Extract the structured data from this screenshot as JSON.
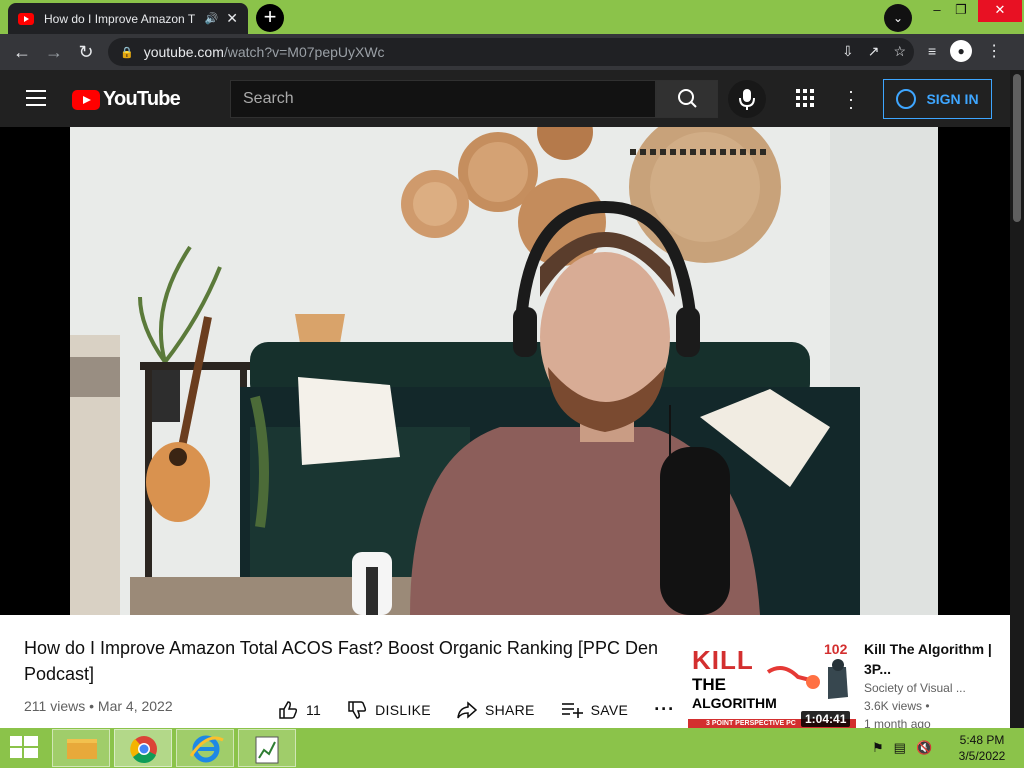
{
  "browser": {
    "tab_title": "How do I Improve Amazon T",
    "new_tab_label": "+",
    "url_host": "youtube.com",
    "url_path": "/watch?v=M07pepUyXWc"
  },
  "youtube": {
    "logo_text": "YouTube",
    "search_placeholder": "Search",
    "sign_in_label": "SIGN IN"
  },
  "video": {
    "title": "How do I Improve Amazon Total ACOS Fast? Boost Organic Ranking [PPC Den Podcast]",
    "views": "211 views",
    "date": "Mar 4, 2022",
    "like_count": "11",
    "dislike_label": "DISLIKE",
    "share_label": "SHARE",
    "save_label": "SAVE"
  },
  "recommended": [
    {
      "title": "Kill The Algorithm | 3P...",
      "channel": "Society of Visual ...",
      "views": "3.6K views •",
      "age": "1 month ago",
      "duration": "1:04:41",
      "thumb_kill": "KILL",
      "thumb_the": "THE",
      "thumb_algorithm": "ALGORITHM",
      "thumb_number": "102",
      "thumb_banner": "3 POINT PERSPECTIVE PC"
    }
  ],
  "taskbar": {
    "time": "5:48 PM",
    "date": "3/5/2022"
  },
  "colors": {
    "accent_green": "#8bc34a",
    "youtube_red": "#ff0000",
    "link_blue": "#3ea6ff"
  }
}
